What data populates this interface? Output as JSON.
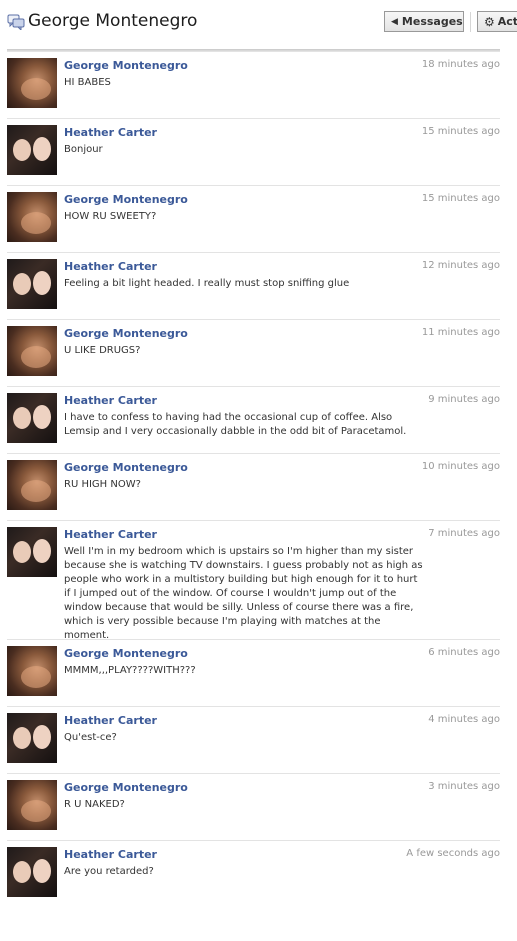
{
  "header": {
    "title": "George Montenegro",
    "title_icon": "chat-bubbles-icon",
    "messages_label": "Messages",
    "messages_icon": "triangle-left-icon",
    "actions_label": "Act",
    "actions_icon": "gear-icon"
  },
  "colors": {
    "name": "#3b5998",
    "timestamp": "#999999",
    "text": "#333333"
  },
  "messages": [
    {
      "sender": "George Montenegro",
      "time": "18 minutes ago",
      "text": "HI BABES"
    },
    {
      "sender": "Heather Carter",
      "time": "15 minutes ago",
      "text": "Bonjour"
    },
    {
      "sender": "George Montenegro",
      "time": "15 minutes ago",
      "text": "HOW RU SWEETY?"
    },
    {
      "sender": "Heather Carter",
      "time": "12 minutes ago",
      "text": "Feeling a bit light headed. I really must stop sniffing glue"
    },
    {
      "sender": "George Montenegro",
      "time": "11 minutes ago",
      "text": "U LIKE DRUGS?"
    },
    {
      "sender": "Heather Carter",
      "time": "9 minutes ago",
      "text": "I have to confess to having had the occasional cup of coffee. Also Lemsip and I very occasionally dabble in the odd bit of Paracetamol."
    },
    {
      "sender": "George Montenegro",
      "time": "10 minutes ago",
      "text": "RU HIGH NOW?"
    },
    {
      "sender": "Heather Carter",
      "time": "7 minutes ago",
      "text": "Well I'm in my bedroom which is upstairs so I'm higher than my sister because she is watching TV downstairs. I guess probably not as high as people who work in a multistory building but high enough for it to hurt if I jumped out of the window. Of course I wouldn't jump out of the window because that would be silly. Unless of course there was a fire, which is very possible because I'm playing with matches at the moment."
    },
    {
      "sender": "George Montenegro",
      "time": "6 minutes ago",
      "text": "MMMM,,,PLAY????WITH???"
    },
    {
      "sender": "Heather Carter",
      "time": "4 minutes ago",
      "text": "Qu'est-ce?"
    },
    {
      "sender": "George Montenegro",
      "time": "3 minutes ago",
      "text": "R U NAKED?"
    },
    {
      "sender": "Heather Carter",
      "time": "A few seconds ago",
      "text": "Are you retarded?"
    }
  ]
}
